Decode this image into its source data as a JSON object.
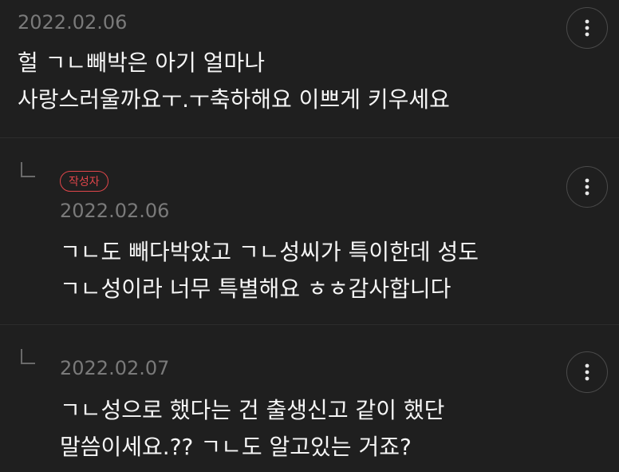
{
  "comments": [
    {
      "date": "2022.02.06",
      "lines": [
        "헐 ㄱㄴ빼박은 아기 얼마나",
        "사랑스러울까요ㅜ.ㅜ축하해요 이쁘게 키우세요"
      ],
      "more_icon": "more-vertical-icon"
    },
    {
      "badge": "작성자",
      "date": "2022.02.06",
      "lines": [
        "ㄱㄴ도 빼다박았고 ㄱㄴ성씨가 특이한데 성도",
        "ㄱㄴ성이라 너무 특별해요 ㅎㅎ감사합니다"
      ],
      "reply_icon": "reply-arrow-icon",
      "more_icon": "more-vertical-icon"
    },
    {
      "date": "2022.02.07",
      "lines": [
        "ㄱㄴ성으로 했다는 건 출생신고 같이 했단",
        "말씀이세요.?? ㄱㄴ도 알고있는 거죠?"
      ],
      "reply_icon": "reply-arrow-icon",
      "more_icon": "more-vertical-icon"
    }
  ],
  "colors": {
    "background": "#1f1f1f",
    "text": "#f5f5f5",
    "date": "#7a7a7a",
    "badge": "#e0464a"
  }
}
